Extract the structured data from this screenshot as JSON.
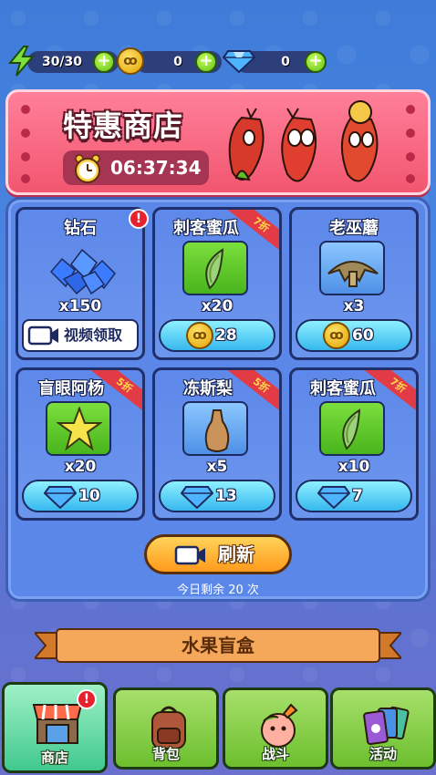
{
  "resources": {
    "energy": "30/30",
    "coins": "0",
    "gems": "0"
  },
  "banner": {
    "title": "特惠商店",
    "timer": "06:37:34"
  },
  "shop": {
    "items": [
      {
        "name": "钻石",
        "qty": "x150",
        "cost_type": "video",
        "cost_label": "视频领取",
        "badge": "!"
      },
      {
        "name": "刺客蜜瓜",
        "qty": "x20",
        "cost_type": "coin",
        "price": "28",
        "discount": "7折"
      },
      {
        "name": "老巫蘑",
        "qty": "x3",
        "cost_type": "coin",
        "price": "60"
      },
      {
        "name": "盲眼阿杨",
        "qty": "x20",
        "cost_type": "gem",
        "price": "10",
        "discount": "5折"
      },
      {
        "name": "冻斯梨",
        "qty": "x5",
        "cost_type": "gem",
        "price": "13",
        "discount": "5折"
      },
      {
        "name": "刺客蜜瓜",
        "qty": "x10",
        "cost_type": "gem",
        "price": "7",
        "discount": "7折"
      }
    ],
    "refresh_label": "刷新",
    "remaining": "今日剩余 20 次"
  },
  "fruit_box": "水果盲盒",
  "nav": [
    {
      "label": "商店",
      "active": true,
      "badge": "!"
    },
    {
      "label": "背包"
    },
    {
      "label": "战斗"
    },
    {
      "label": "活动"
    }
  ],
  "colors": {
    "background": "#4a86e2",
    "banner": "#f2566f",
    "panel": "#5b87e8",
    "price_button": "#37b8ef",
    "refresh_button": "#ff9a1b",
    "nav_active": "#41c98f",
    "nav_inactive": "#6cbf2e"
  }
}
